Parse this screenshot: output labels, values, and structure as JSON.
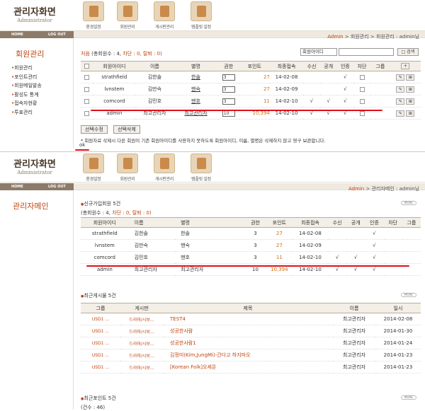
{
  "header": {
    "title": "관리자화면",
    "subtitle": "Administrator",
    "menu": [
      "환경설정",
      "회원관리",
      "게시판관리",
      "템플릿 설정"
    ]
  },
  "topbar": {
    "home": "HOME",
    "logout": "LOG OUT"
  },
  "panel1": {
    "breadcrumb": {
      "admin": "Admin",
      "sep": ">",
      "mid": "회원관리",
      "cur": "회원관리",
      "user": ": admin님"
    },
    "side_title": "회원관리",
    "side_items": [
      "회원관리",
      "포인트관리",
      "회원메일발송",
      "활성도 통계",
      "접속자현황",
      "투표관리"
    ],
    "summary": {
      "all": "처음",
      "total": "(총회원수 : 4,",
      "block": "차단 : 0,",
      "leave": "탈퇴 : 0)"
    },
    "search": {
      "select": "회원아이디",
      "button": "검색"
    },
    "columns": [
      "회원아이디",
      "이름",
      "별명",
      "권한",
      "포인트",
      "최종접속",
      "수신",
      "공개",
      "인증",
      "차단",
      "그룹"
    ],
    "rows": [
      {
        "id": "strathfield",
        "name": "김한솔",
        "nick": "한솔",
        "level": "3",
        "point": "27",
        "date": "14-02-08",
        "recv": "",
        "open": "",
        "auth": "√",
        "block": "cb"
      },
      {
        "id": "lvnstem",
        "name": "김만숙",
        "nick": "맨숙",
        "level": "3",
        "point": "27",
        "date": "14-02-09",
        "recv": "",
        "open": "",
        "auth": "√",
        "block": "cb"
      },
      {
        "id": "comcord",
        "name": "김민호",
        "nick": "맨호",
        "level": "3",
        "point": "11",
        "date": "14-02-10",
        "recv": "√",
        "open": "√",
        "auth": "√",
        "block": "cb"
      },
      {
        "id": "admin",
        "name": "최고관리자",
        "nick": "최고관리자",
        "level": "10",
        "point": "10,394",
        "date": "14-02-10",
        "recv": "√",
        "open": "√",
        "auth": "√",
        "block": "cb"
      }
    ],
    "btn_edit": "선택수정",
    "btn_delete": "선택삭제",
    "notice": "* 회원자료 삭제시 다른 회원이 기존 회원아이디를 사용하지 못하도록 회원아이디, 이름, 별명은 삭제하지 않고 영구 보관합니다.",
    "ok": "ok"
  },
  "panel2": {
    "breadcrumb": {
      "admin": "Admin",
      "sep": ">",
      "cur": "관리자메인",
      "user": ": admin님"
    },
    "side_title": "관리자메인",
    "new_members": {
      "title": "신규가입회원 5건",
      "more": "MORE",
      "summary": {
        "total": "(총회원수 : 4,",
        "block": "차단 : 0,",
        "leave": "탈퇴 : 0)"
      },
      "columns": [
        "회원아이디",
        "이름",
        "별명",
        "권한",
        "포인트",
        "최종접속",
        "수신",
        "공개",
        "인증",
        "차단",
        "그룹"
      ],
      "rows": [
        {
          "id": "strathfield",
          "name": "김한솔",
          "nick": "한솔",
          "level": "3",
          "point": "27",
          "date": "14-02-08",
          "recv": "",
          "open": "",
          "auth": "√"
        },
        {
          "id": "lvnstem",
          "name": "김만숙",
          "nick": "맨숙",
          "level": "3",
          "point": "27",
          "date": "14-02-09",
          "recv": "",
          "open": "",
          "auth": "√"
        },
        {
          "id": "comcord",
          "name": "김민호",
          "nick": "맨호",
          "level": "3",
          "point": "11",
          "date": "14-02-10",
          "recv": "√",
          "open": "√",
          "auth": "√"
        },
        {
          "id": "admin",
          "name": "최고관리자",
          "nick": "최고관리자",
          "level": "10",
          "point": "10,394",
          "date": "14-02-10",
          "recv": "√",
          "open": "√",
          "auth": "√"
        }
      ]
    },
    "recent_posts": {
      "title": "최근게시물 5건",
      "more": "MORE",
      "columns": [
        "그룹",
        "게시판",
        "제목",
        "이름",
        "일시"
      ],
      "rows": [
        {
          "group": "USD1 ...",
          "board": "드라마/시보...",
          "subject": "TEST4",
          "name": "최고관리자",
          "date": "2014-02-08"
        },
        {
          "group": "USD1 ...",
          "board": "드라마/시보...",
          "subject": "성공한사람",
          "name": "최고관리자",
          "date": "2014-01-30"
        },
        {
          "group": "USD1 ...",
          "board": "드라마/시보...",
          "subject": "성공한사람1",
          "name": "최고관리자",
          "date": "2014-01-24"
        },
        {
          "group": "USD1 ...",
          "board": "드라마/시보...",
          "subject": "김정미(Kim,JungMi)-간다고 하지마오",
          "name": "최고관리자",
          "date": "2014-01-23"
        },
        {
          "group": "USD1 ...",
          "board": "드라마/시보...",
          "subject": "[Korean Folk]오세온",
          "name": "최고관리자",
          "date": "2014-01-23"
        }
      ]
    },
    "recent_points": {
      "title": "최근포인트 5건",
      "more": "MORE",
      "summary": "(건수 : 46)"
    }
  },
  "colors": {
    "accent": "#c1440e",
    "point": "#d4700c",
    "highlight": "#e0101a"
  }
}
